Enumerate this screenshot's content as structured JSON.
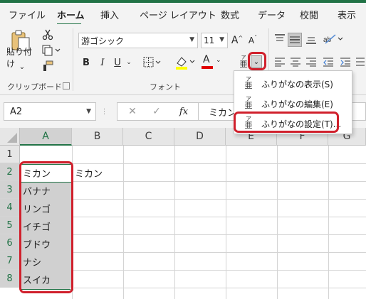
{
  "ribbon_tabs": [
    {
      "label": "ファイル"
    },
    {
      "label": "ホーム",
      "active": true
    },
    {
      "label": "挿入"
    },
    {
      "label": "ページ レイアウト"
    },
    {
      "label": "数式"
    },
    {
      "label": "データ"
    },
    {
      "label": "校閲"
    },
    {
      "label": "表示"
    }
  ],
  "clipboard": {
    "paste_label": "貼り付け",
    "paste_sub": "⌄",
    "group_label": "クリップボード"
  },
  "font": {
    "font_name": "游ゴシック",
    "font_size": "11",
    "grow_label": "A",
    "shrink_label": "A",
    "bold": "B",
    "italic": "I",
    "underline": "U",
    "font_color_letter": "A",
    "group_label": "フォント",
    "furigana_icon": "亜",
    "furigana_ruby": "ア"
  },
  "furigana_menu": {
    "items": [
      {
        "label": "ふりがなの表示(S)",
        "icon_ruby": "ア",
        "icon_base": "亜"
      },
      {
        "label": "ふりがなの編集(E)",
        "icon_ruby": "ア",
        "icon_base": "亜"
      },
      {
        "label": "ふりがなの設定(T)...",
        "icon_ruby": "ア",
        "icon_base": "亜",
        "highlighted": true
      }
    ]
  },
  "formula_bar": {
    "name_box": "A2",
    "fx": "fx",
    "content": "ミカン"
  },
  "sheet": {
    "columns": [
      "A",
      "B",
      "C",
      "D",
      "E",
      "F",
      "G"
    ],
    "rows": [
      "1",
      "2",
      "3",
      "4",
      "5",
      "6",
      "7",
      "8"
    ],
    "cells": {
      "A2": "ミカン",
      "B2": "ミカン",
      "A3": "バナナ",
      "A4": "リンゴ",
      "A5": "イチゴ",
      "A6": "ブドウ",
      "A7": "ナシ",
      "A8": "スイカ"
    }
  },
  "colors": {
    "excel_green": "#217346",
    "annotation_red": "#d0202c",
    "font_color_bar": "#e00000",
    "highlight_bar": "#ffff00"
  }
}
